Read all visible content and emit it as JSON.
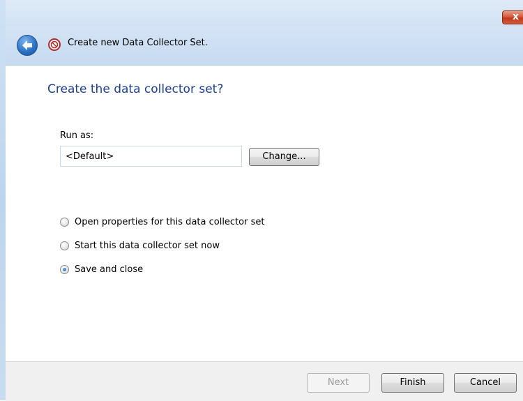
{
  "window": {
    "title": "Create new Data Collector Set.",
    "close_glyph": "x"
  },
  "icons": {
    "back": "back-arrow-icon",
    "wizard": "no-symbol-icon",
    "close": "close-icon"
  },
  "content": {
    "heading": "Create the data collector set?",
    "run_as_label": "Run as:",
    "run_as_value": "<Default>",
    "change_label": "Change..."
  },
  "options": [
    {
      "label": "Open properties for this data collector set",
      "checked": false
    },
    {
      "label": "Start this data collector set now",
      "checked": false
    },
    {
      "label": "Save and close",
      "checked": true
    }
  ],
  "footer": {
    "next_label": "Next",
    "finish_label": "Finish",
    "cancel_label": "Cancel"
  },
  "colors": {
    "heading": "#1e3f8f",
    "header_bg": "#d5e4f5",
    "close_button": "#c23a1c"
  }
}
